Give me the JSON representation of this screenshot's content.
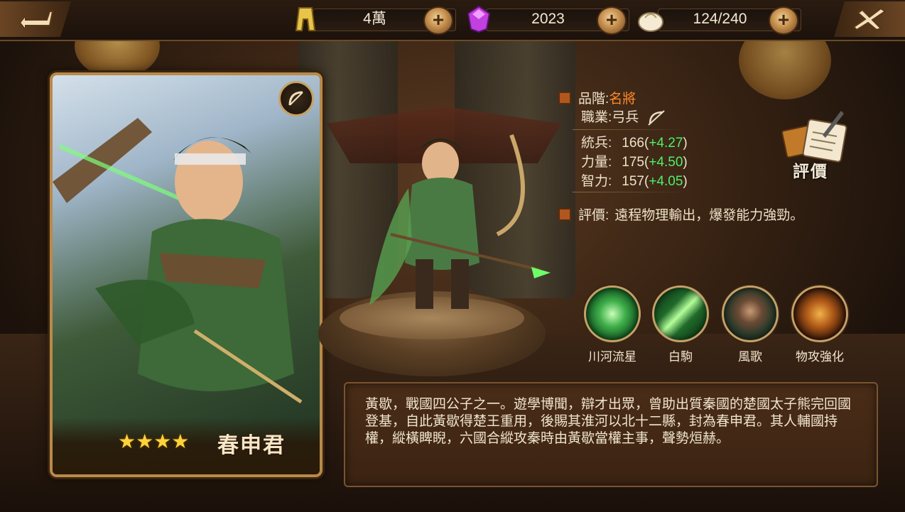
{
  "topbar": {
    "currencies": [
      {
        "icon": "stamp-token-icon",
        "value": "4萬"
      },
      {
        "icon": "purple-gem-icon",
        "value": "2023"
      },
      {
        "icon": "steamed-bun-icon",
        "value": "124/240"
      }
    ]
  },
  "card": {
    "name": "春申君",
    "stars": 4,
    "stars_text": "★★★★",
    "class_icon": "bow-icon"
  },
  "stats": {
    "grade_label": "品階:",
    "grade_value": "名將",
    "job_label": "職業:",
    "job_value": "弓兵",
    "command_label": "統兵:",
    "command_value": "166",
    "command_growth": "+4.27",
    "power_label": "力量:",
    "power_value": "175",
    "power_growth": "+4.50",
    "intel_label": "智力:",
    "intel_value": "157",
    "intel_growth": "+4.05",
    "review_label": "評價:",
    "review_text": "遠程物理輸出，爆發能力強勁。"
  },
  "review_button": {
    "label": "評價"
  },
  "skills": [
    {
      "name": "川河流星",
      "icon": "arrow-swirl-skill-icon"
    },
    {
      "name": "白駒",
      "icon": "green-beam-skill-icon"
    },
    {
      "name": "風歌",
      "icon": "hero-portrait-skill-icon"
    },
    {
      "name": "物攻強化",
      "icon": "fist-burst-skill-icon"
    }
  ],
  "description": "黃歇，戰國四公子之一。遊學博聞，辯才出眾，曾助出質秦國的楚國太子熊完回國登基，自此黃歇得楚王重用，後賜其淮河以北十二縣，封為春申君。其人輔國持權，縱橫睥睨，六國合縱攻秦時由黃歇當權主事，聲勢烜赫。",
  "colors": {
    "grade": "#ff8a2a",
    "growth": "#4df06a",
    "frame_gold": "#b88a4a"
  }
}
